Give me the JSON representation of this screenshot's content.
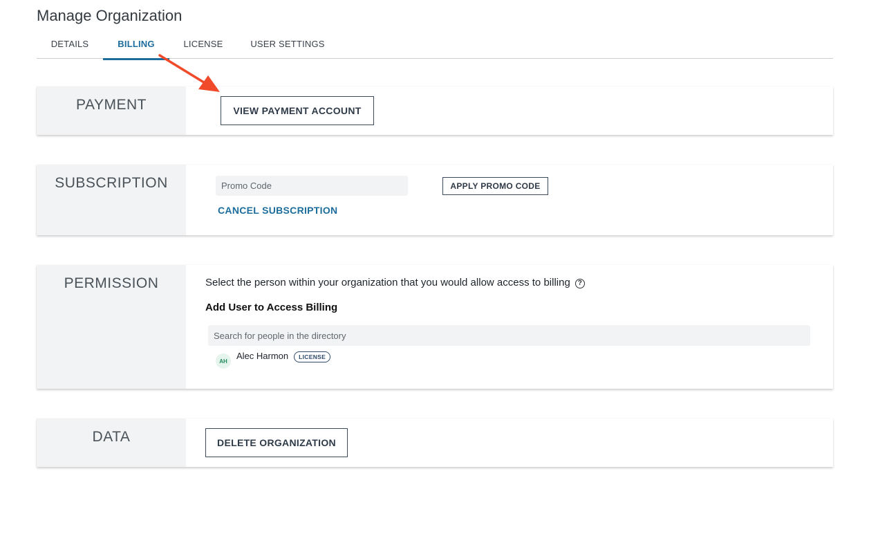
{
  "page": {
    "title": "Manage Organization"
  },
  "tabs": [
    {
      "label": "DETAILS",
      "active": false
    },
    {
      "label": "BILLING",
      "active": true
    },
    {
      "label": "LICENSE",
      "active": false
    },
    {
      "label": "USER SETTINGS",
      "active": false
    }
  ],
  "payment": {
    "label": "PAYMENT",
    "view_button": "VIEW PAYMENT ACCOUNT"
  },
  "subscription": {
    "label": "SUBSCRIPTION",
    "promo_placeholder": "Promo Code",
    "promo_value": "",
    "apply_button": "APPLY PROMO CODE",
    "cancel_link": "CANCEL SUBSCRIPTION"
  },
  "permission": {
    "label": "PERMISSION",
    "description": "Select the person within your organization that you would allow access to billing",
    "help_glyph": "?",
    "subheading": "Add User to Access Billing",
    "search_placeholder": "Search for people in the directory",
    "search_value": "",
    "users": [
      {
        "initials": "AH",
        "name": "Alec Harmon",
        "badge": "LICENSE"
      }
    ]
  },
  "data_section": {
    "label": "DATA",
    "delete_button": "DELETE ORGANIZATION"
  },
  "colors": {
    "accent": "#1c6d9c",
    "annotation_arrow": "#f04a2a",
    "panel_bg": "#f2f3f4",
    "button_border": "#3b4a5a"
  }
}
